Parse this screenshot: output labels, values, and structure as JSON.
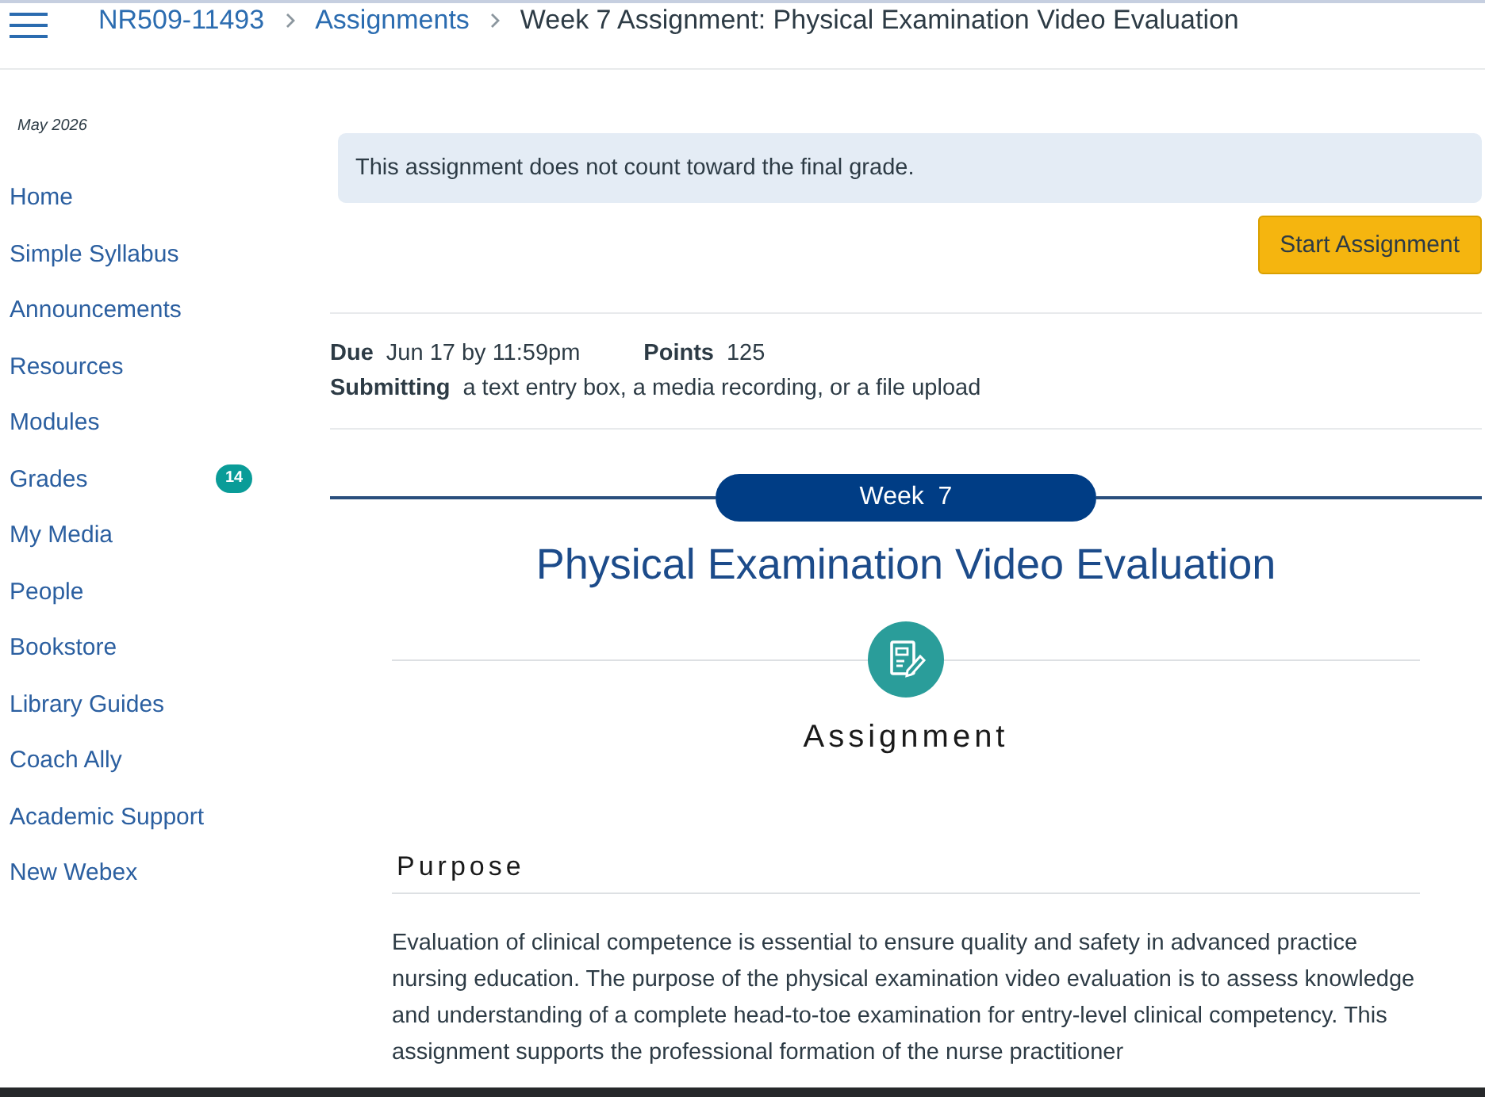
{
  "header": {
    "breadcrumbs": [
      {
        "label": "NR509-11493",
        "kind": "link"
      },
      {
        "label": "Assignments",
        "kind": "link"
      },
      {
        "label": "Week 7 Assignment: Physical Examination Video Evaluation",
        "kind": "current"
      }
    ]
  },
  "sidebar": {
    "term": "May 2026",
    "items": [
      {
        "label": "Home"
      },
      {
        "label": "Simple Syllabus"
      },
      {
        "label": "Announcements"
      },
      {
        "label": "Resources"
      },
      {
        "label": "Modules"
      },
      {
        "label": "Grades",
        "badge": "14"
      },
      {
        "label": "My Media"
      },
      {
        "label": "People"
      },
      {
        "label": "Bookstore"
      },
      {
        "label": "Library Guides"
      },
      {
        "label": "Coach Ally"
      },
      {
        "label": "Academic Support"
      },
      {
        "label": "New Webex"
      }
    ]
  },
  "notice": "This assignment does not count toward the final grade.",
  "start_button": "Start Assignment",
  "details": {
    "due_label": "Due",
    "due": "Jun 17 by 11:59pm",
    "points_label": "Points",
    "points": "125",
    "submitting_label": "Submitting",
    "submitting": "a text entry box, a media recording, or a file upload"
  },
  "content": {
    "banner": "Week  7",
    "title": "Physical Examination Video Evaluation",
    "section_label": "Assignment",
    "heading": "Purpose",
    "paragraph": "Evaluation of clinical competence is essential to ensure quality and safety in advanced practice nursing education. The purpose of the physical examination video evaluation is to assess knowledge and understanding of a complete head-to-toe examination for entry-level clinical competency. This assignment supports the professional formation of the nurse practitioner"
  }
}
